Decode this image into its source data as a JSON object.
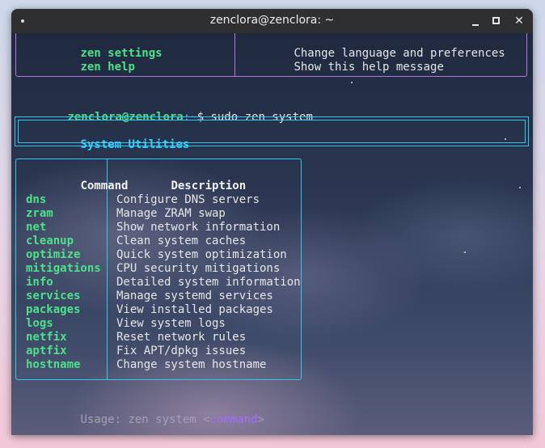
{
  "window": {
    "title": "zenclora@zenclora: ~"
  },
  "prev_table": {
    "rows": [
      {
        "command": "zen settings",
        "description": "Change language and preferences"
      },
      {
        "command": "zen help",
        "description": "Show this help message"
      }
    ]
  },
  "prompt": {
    "user_host": "zenclora@zenclora",
    "path": ":~",
    "symbol": "$ ",
    "command": "sudo zen system"
  },
  "header": {
    "title": "System Utilities"
  },
  "cmd_table": {
    "headers": {
      "command": "Command",
      "description": "Description"
    },
    "rows": [
      {
        "command": "dns",
        "description": "Configure DNS servers"
      },
      {
        "command": "zram",
        "description": "Manage ZRAM swap"
      },
      {
        "command": "net",
        "description": "Show network information"
      },
      {
        "command": "cleanup",
        "description": "Clean system caches"
      },
      {
        "command": "optimize",
        "description": "Quick system optimization"
      },
      {
        "command": "mitigations",
        "description": "CPU security mitigations"
      },
      {
        "command": "info",
        "description": "Detailed system information"
      },
      {
        "command": "services",
        "description": "Manage systemd services"
      },
      {
        "command": "packages",
        "description": "View installed packages"
      },
      {
        "command": "logs",
        "description": "View system logs"
      },
      {
        "command": "netfix",
        "description": "Reset network rules"
      },
      {
        "command": "aptfix",
        "description": "Fix APT/dpkg issues"
      },
      {
        "command": "hostname",
        "description": "Change system hostname"
      }
    ]
  },
  "usage": {
    "prefix": "Usage: zen system <",
    "arg": "command",
    "suffix": ">"
  },
  "colors": {
    "command_green": "#4ee08a",
    "border_cyan": "#35c6e8",
    "border_purple": "#b276d8",
    "header_cyan": "#35d0ff",
    "path_blue": "#6aa0ff",
    "arg_purple": "#a66cff"
  }
}
